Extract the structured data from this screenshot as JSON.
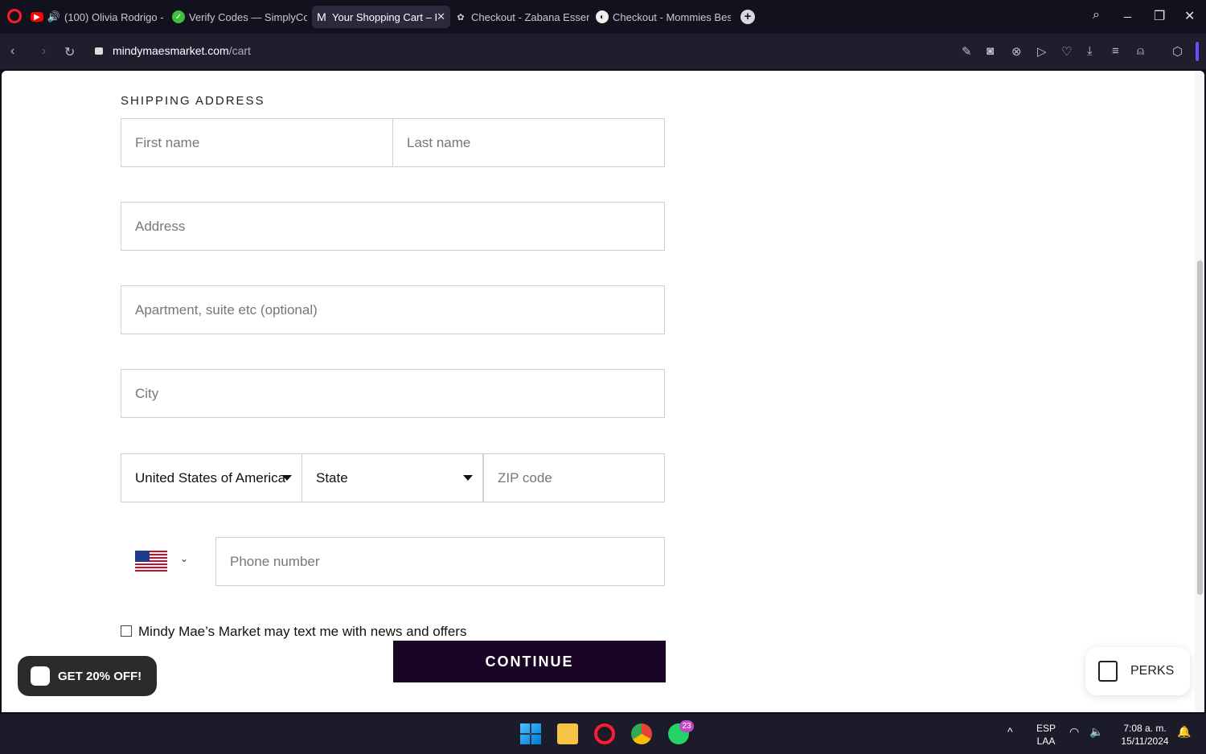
{
  "browser": {
    "tabs": [
      {
        "label": "(100) Olivia Rodrigo -  ",
        "active": false,
        "icon": "youtube-icon"
      },
      {
        "label": "Verify Codes — SimplyCo",
        "active": false,
        "icon": "check-circle-icon"
      },
      {
        "label": "Your Shopping Cart – I",
        "active": true,
        "icon": "m-logo-icon"
      },
      {
        "label": "Checkout - Zabana Essent",
        "active": false,
        "icon": "script-logo-icon"
      },
      {
        "label": "Checkout - Mommies Best",
        "active": false,
        "icon": "globe-icon"
      }
    ],
    "url_host": "mindymaesmarket.com",
    "url_path": "/cart"
  },
  "form": {
    "section_title": "SHIPPING ADDRESS",
    "first_name_placeholder": "First name",
    "last_name_placeholder": "Last name",
    "address_placeholder": "Address",
    "apartment_placeholder": "Apartment, suite etc (optional)",
    "city_placeholder": "City",
    "country_value": "United States of America",
    "state_value": "State",
    "zip_placeholder": "ZIP code",
    "phone_placeholder": "Phone number",
    "sms_optin_label": "Mindy Mae’s Market may text me with news and offers",
    "continue_label": "CONTINUE"
  },
  "widgets": {
    "promo_label": "GET 20% OFF!",
    "perks_label": "PERKS"
  },
  "taskbar": {
    "whatsapp_badge": "23",
    "lang_top": "ESP",
    "lang_bottom": "LAA",
    "time": "7:08 a. m.",
    "date": "15/11/2024"
  },
  "colors": {
    "continue_bg": "#1a0526",
    "tabbar_bg": "#12121e",
    "accent_red": "#ff1b2d"
  }
}
